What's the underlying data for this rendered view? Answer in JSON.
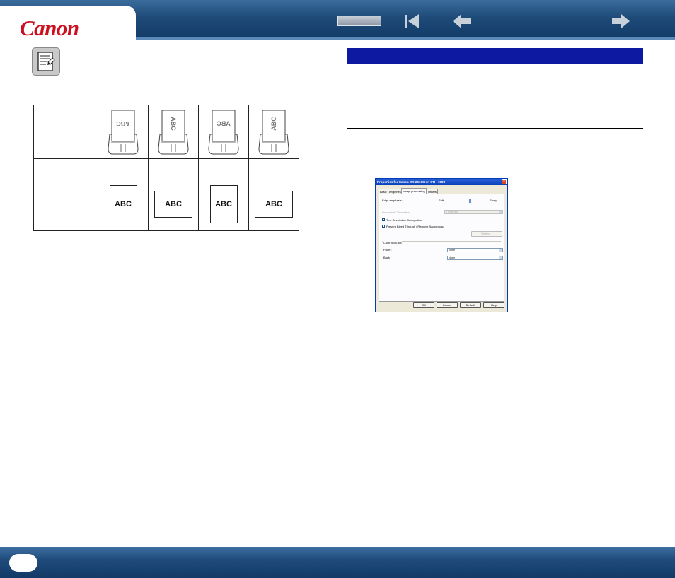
{
  "header": {
    "logo": "Canon"
  },
  "table": {
    "columns": [
      {
        "feeder_text": "ABC",
        "rotation": 180,
        "output_text": "ABC",
        "output_shape": "portrait"
      },
      {
        "feeder_text": "ABC",
        "rotation": 90,
        "output_text": "ABC",
        "output_shape": "landscape"
      },
      {
        "feeder_text": "ABC",
        "rotation": 0,
        "output_text": "ABC",
        "output_shape": "portrait",
        "mirrored": true
      },
      {
        "feeder_text": "ABC",
        "rotation": 270,
        "output_text": "ABC",
        "output_shape": "landscape"
      }
    ]
  },
  "dialog": {
    "title": "Properties for Canon DR-2510C on STI - 0000",
    "tabs": [
      "Basic",
      "Brightness",
      "Image processing",
      "Others"
    ],
    "active_tab": "Image processing",
    "edge_label": "Edge emphasis:",
    "edge_soft": "Soft",
    "edge_sharp": "Sharp",
    "doc_orientation_label": "Document Orientation:",
    "doc_orientation_value": "0 degrees",
    "text_orientation_label": "Text Orientation Recognition",
    "bleed_label": "Prevent Bleed Through / Remove Background",
    "setting_label": "Setting...",
    "color_dropout_label": "Color drop-out",
    "front_label": "Front :",
    "front_value": "None",
    "back_label": "Back :",
    "back_value": "None",
    "ok_label": "OK",
    "cancel_label": "Cancel",
    "default_label": "Default",
    "help_label": "Help"
  },
  "colors": {
    "accent_bar": "#0c19a0",
    "header": "#1e4a78",
    "logo": "#cc1020"
  }
}
